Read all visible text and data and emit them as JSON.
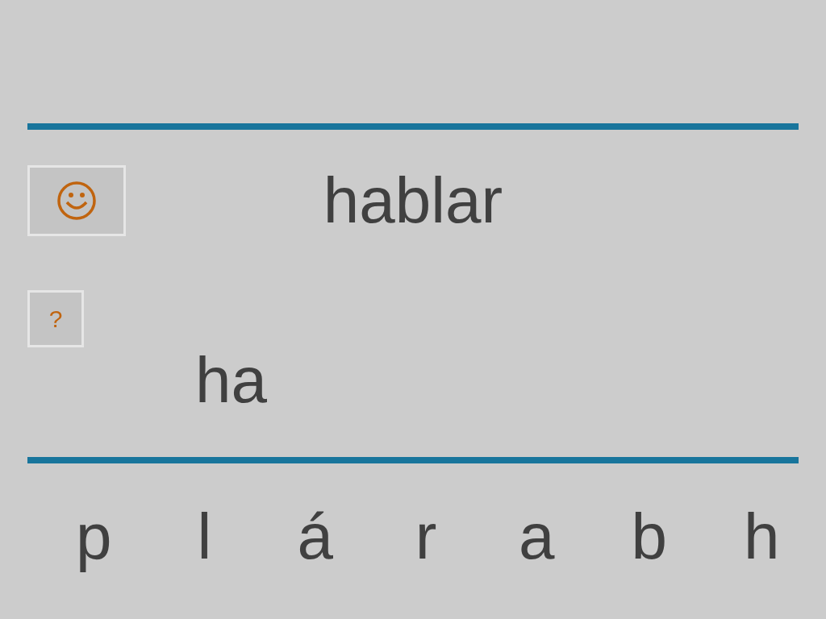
{
  "word": "hablar",
  "hint_button": {
    "label": "?"
  },
  "answer": "ha",
  "letters": [
    "p",
    "l",
    "á",
    "r",
    "a",
    "b",
    "h"
  ]
}
